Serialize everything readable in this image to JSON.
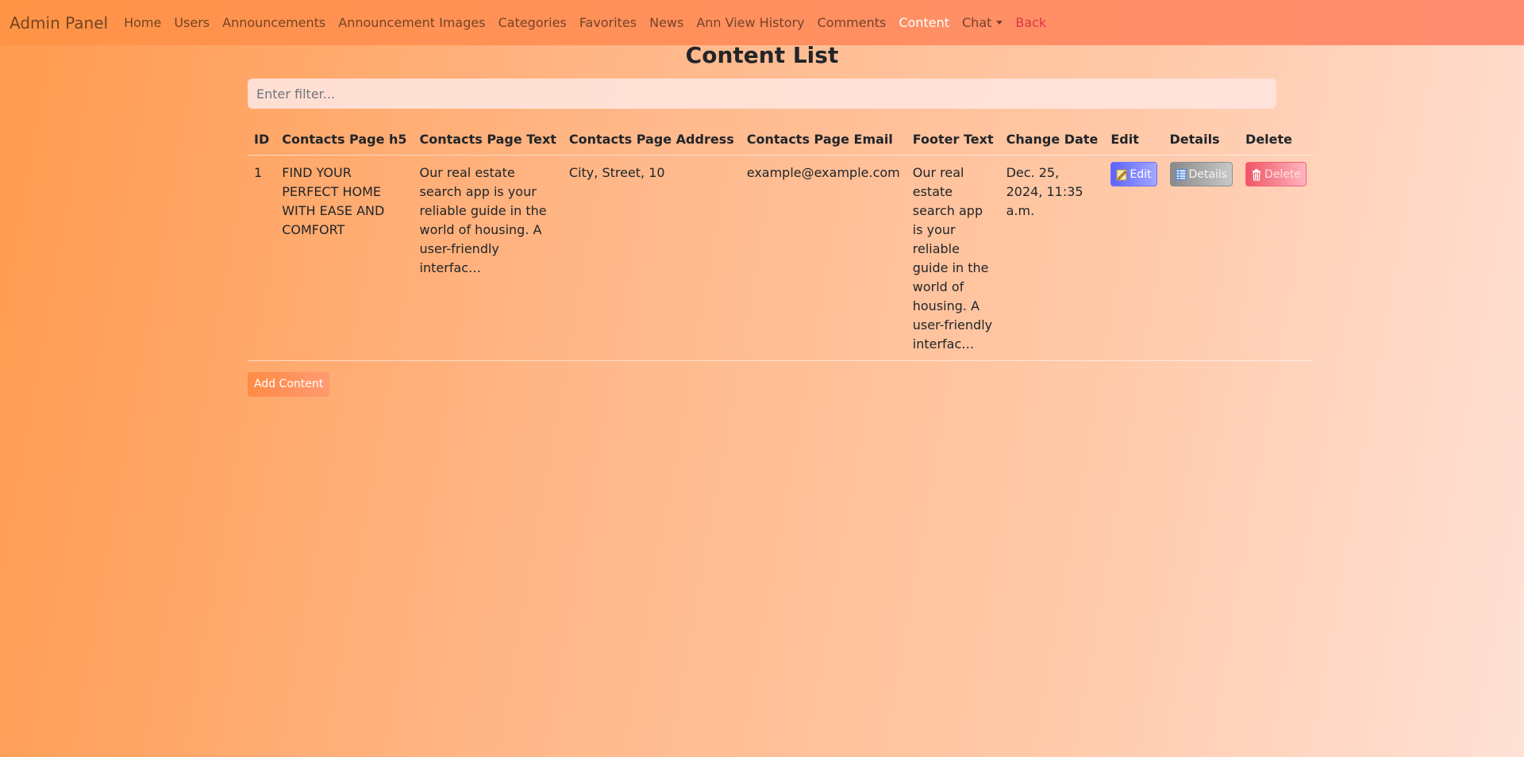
{
  "navbar": {
    "brand": "Admin Panel",
    "links": [
      {
        "label": "Home"
      },
      {
        "label": "Users"
      },
      {
        "label": "Announcements"
      },
      {
        "label": "Announcement Images"
      },
      {
        "label": "Categories"
      },
      {
        "label": "Favorites"
      },
      {
        "label": "News"
      },
      {
        "label": "Ann View History"
      },
      {
        "label": "Comments"
      },
      {
        "label": "Content",
        "active": true
      }
    ],
    "chat_label": "Chat",
    "back_label": "Back"
  },
  "main": {
    "title": "Content List",
    "filter_placeholder": "Enter filter...",
    "filter_value": "",
    "columns": [
      "ID",
      "Contacts Page h5",
      "Contacts Page Text",
      "Contacts Page Address",
      "Contacts Page Email",
      "Footer Text",
      "Change Date",
      "Edit",
      "Details",
      "Delete"
    ],
    "rows": [
      {
        "id": "1",
        "h5": "FIND YOUR PERFECT HOME WITH EASE AND COMFORT",
        "text": "Our real estate search app is your reliable guide in the world of housing. A user-friendly interfac…",
        "address": "City, Street, 10",
        "email": "example@example.com",
        "footer": "Our real estate search app is your reliable guide in the world of housing. A user-friendly interfac…",
        "date": "Dec. 25, 2024, 11:35 a.m.",
        "edit_label": "Edit",
        "details_label": "Details",
        "delete_label": "Delete"
      }
    ],
    "add_label": "Add Content"
  },
  "icons": {
    "edit": "pencil-square-icon",
    "details": "table-list-icon",
    "delete": "trash-icon",
    "chat_dropdown": "caret-down-icon"
  },
  "colors": {
    "active_nav": "#ffffff",
    "back_link": "#dc3545",
    "edit_button": "#5b63ff",
    "details_button": "#8a8a8a",
    "delete_button": "#f05566",
    "add_button": "#ff8b45"
  }
}
